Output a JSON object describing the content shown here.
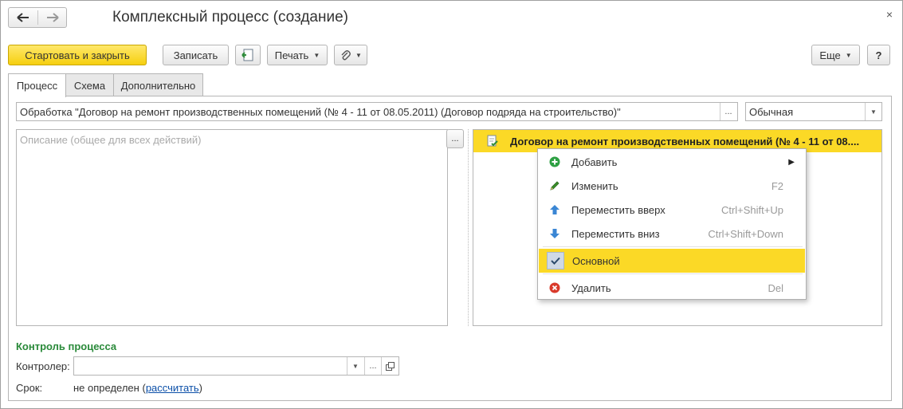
{
  "window": {
    "title": "Комплексный процесс (создание)",
    "close_glyph": "×"
  },
  "nav": {
    "back_glyph": "🡐",
    "forward_glyph": "🡒"
  },
  "toolbar": {
    "start_close": "Стартовать и закрыть",
    "save": "Записать",
    "print": "Печать",
    "more": "Еще",
    "help": "?"
  },
  "tabs": [
    {
      "label": "Процесс",
      "active": true
    },
    {
      "label": "Схема",
      "active": false
    },
    {
      "label": "Дополнительно",
      "active": false
    }
  ],
  "process": {
    "subject": "Обработка \"Договор на ремонт производственных помещений (№ 4 - 11 от 08.05.2011) (Договор подряда на строительство)\"",
    "importance": "Обычная",
    "description_placeholder": "Описание (общее для всех действий)",
    "ellipsis": "..."
  },
  "attachments": {
    "header": "Договор на ремонт производственных помещений (№ 4 - 11 от 08...."
  },
  "context_menu": {
    "items": [
      {
        "label": "Добавить",
        "shortcut": "",
        "icon": "plus-circle-icon",
        "color": "#2ea043"
      },
      {
        "label": "Изменить",
        "shortcut": "F2",
        "icon": "pencil-icon",
        "color": "#3a8f2a"
      },
      {
        "label": "Переместить вверх",
        "shortcut": "Ctrl+Shift+Up",
        "icon": "arrow-up-icon",
        "color": "#3a86d4"
      },
      {
        "label": "Переместить вниз",
        "shortcut": "Ctrl+Shift+Down",
        "icon": "arrow-down-icon",
        "color": "#3a86d4"
      },
      {
        "label": "Основной",
        "shortcut": "",
        "icon": "check-icon",
        "checked": true
      },
      {
        "label": "Удалить",
        "shortcut": "Del",
        "icon": "delete-icon",
        "color": "#d93a2b"
      }
    ],
    "highlight_color": "#fbd926"
  },
  "control": {
    "section_title": "Контроль процесса",
    "controller_label": "Контролер:",
    "controller_value": "",
    "deadline_label": "Срок:",
    "deadline_value": "не определен",
    "deadline_open": "(",
    "deadline_link": "рассчитать",
    "deadline_close": ")"
  },
  "colors": {
    "accent": "#fbd926",
    "section_green": "#2a8a3a",
    "link": "#0b4fa8"
  }
}
